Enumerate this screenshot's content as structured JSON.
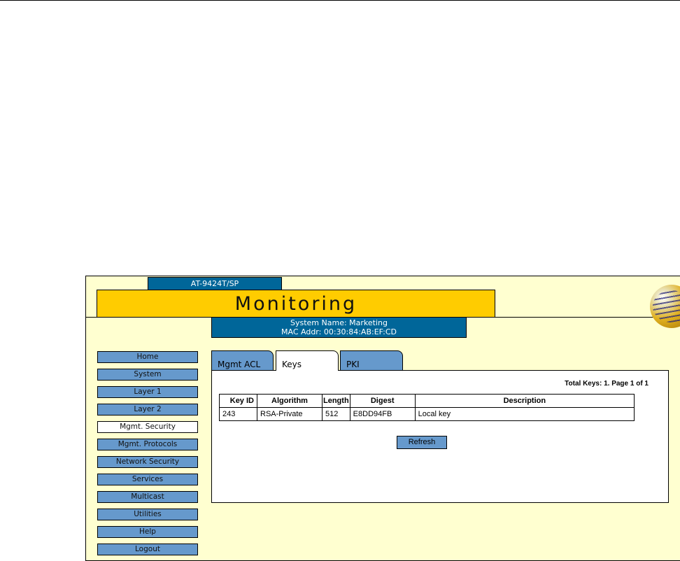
{
  "header": {
    "model": "AT-9424T/SP",
    "title": "Monitoring",
    "system_name": "System Name: Marketing",
    "mac_addr": "MAC Addr: 00:30:84:AB:EF:CD"
  },
  "nav": [
    "Home",
    "System",
    "Layer 1",
    "Layer 2",
    "Mgmt. Security",
    "Mgmt. Protocols",
    "Network Security",
    "Services",
    "Multicast",
    "Utilities",
    "Help",
    "Logout"
  ],
  "tabs": [
    "Mgmt ACL",
    "Keys",
    "PKI"
  ],
  "content": {
    "total": "Total Keys: 1. Page 1 of 1",
    "columns": [
      "Key ID",
      "Algorithm",
      "Length",
      "Digest",
      "Description"
    ],
    "rows": [
      [
        "243",
        "RSA-Private",
        "512",
        "E8DD94FB",
        "Local key"
      ]
    ],
    "refresh_label": "Refresh"
  }
}
